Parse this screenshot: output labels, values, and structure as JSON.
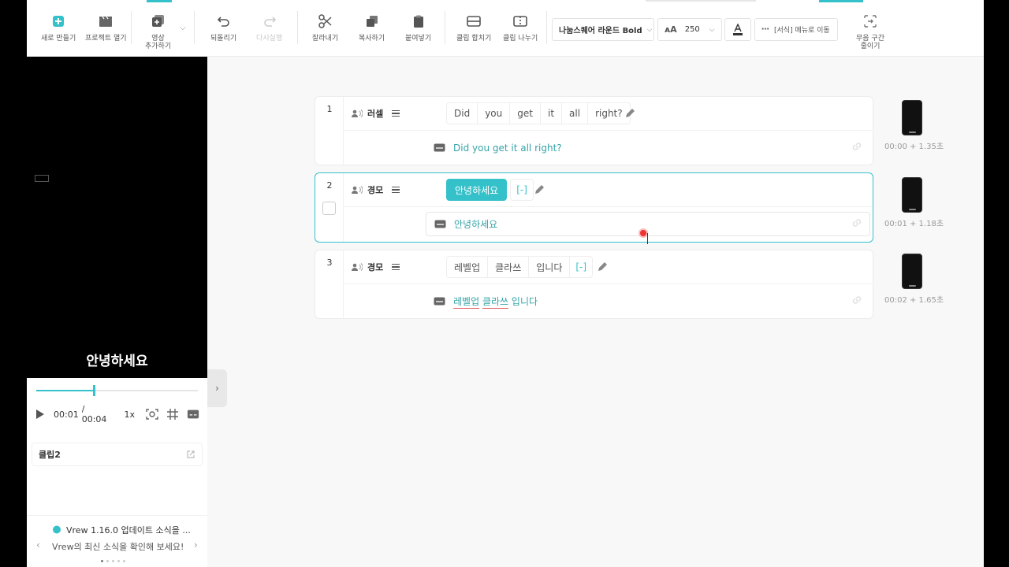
{
  "toolbar": {
    "new": "새로 만들기",
    "open": "프로젝트 열기",
    "add_video_1": "영상",
    "add_video_2": "추가하기",
    "undo": "되돌리기",
    "redo": "다시실행",
    "cut": "잘라내기",
    "copy": "복사하기",
    "paste": "붙여넣기",
    "merge": "클립 합치기",
    "split": "클립 나누기",
    "font": "나눔스퀘어 라운드 Bold",
    "font_size": "250",
    "more": "[서식] 메뉴로 이동",
    "silence_1": "무음 구간",
    "silence_2": "줄이기"
  },
  "preview": {
    "caption": "안녕하세요",
    "progress": 0.35,
    "current_time": "00:01",
    "total_time": "/ 00:04",
    "speed": "1x",
    "clip_name": "클립2"
  },
  "news": {
    "title": "Vrew 1.16.0 업데이트 소식을 ...",
    "subtitle": "Vrew의 최신 소식을 확인해 보세요!"
  },
  "clips": [
    {
      "number": "1",
      "speaker": "러셀",
      "words": [
        "Did",
        "you",
        "get",
        "it",
        "all",
        "right?"
      ],
      "subtitle": "Did you get it all right?",
      "thumb_time": "00:00 + 1.35초"
    },
    {
      "number": "2",
      "speaker": "경모",
      "words": [
        "안녕하세요",
        "[-]"
      ],
      "subtitle": "안녕하세요",
      "thumb_time": "00:01 + 1.18초"
    },
    {
      "number": "3",
      "speaker": "경모",
      "words": [
        "레벨업",
        "클라쓰",
        "입니다",
        "[-]"
      ],
      "subtitle_parts": [
        "레벨업",
        "클라쓰",
        "입니다"
      ],
      "thumb_time": "00:02 + 1.65초"
    }
  ],
  "colors": {
    "accent": "#35c1c9",
    "subtitle_text": "#35a4a8"
  }
}
